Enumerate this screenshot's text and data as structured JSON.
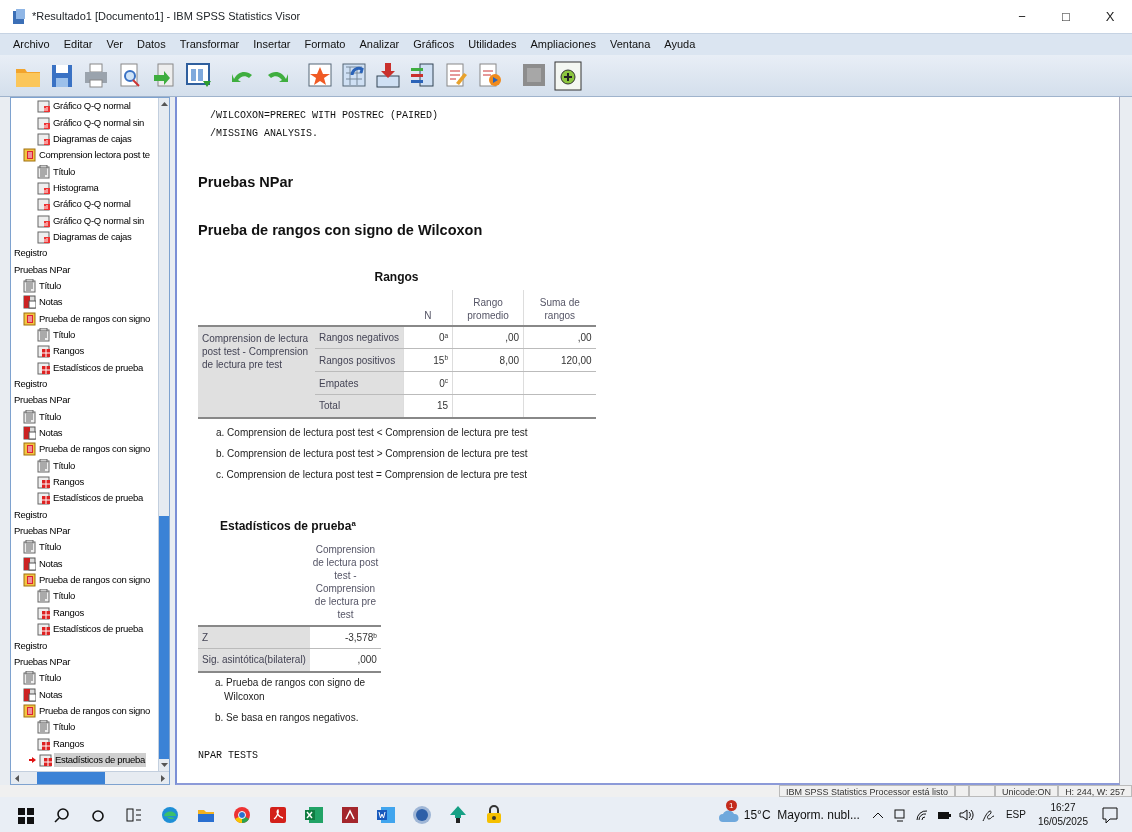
{
  "window": {
    "title": "*Resultado1 [Documento1] - IBM SPSS Statistics Visor",
    "controls": [
      "−",
      "□",
      "X"
    ]
  },
  "menu": [
    "Archivo",
    "Editar",
    "Ver",
    "Datos",
    "Transformar",
    "Insertar",
    "Formato",
    "Analizar",
    "Gráficos",
    "Utilidades",
    "Ampliaciones",
    "Ventana",
    "Ayuda"
  ],
  "tree": [
    {
      "children": [
        {
          "children": [
            {
              "label": "Gráfico Q-Q normal",
              "kind": "chart",
              "selected": false
            },
            {
              "label": "Gráfico Q-Q normal sin",
              "kind": "chart",
              "selected": false
            },
            {
              "label": "Diagramas de cajas",
              "kind": "chart",
              "selected": false
            }
          ]
        },
        {
          "label": "Comprension lectora post te",
          "kind": "heading",
          "selected": false,
          "children": [
            {
              "label": "Título",
              "kind": "title",
              "selected": false
            },
            {
              "label": "Histograma",
              "kind": "chart",
              "selected": false
            },
            {
              "label": "Gráfico Q-Q normal",
              "kind": "chart",
              "selected": false
            },
            {
              "label": "Gráfico Q-Q normal sin",
              "kind": "chart",
              "selected": false
            },
            {
              "label": "Diagramas de cajas",
              "kind": "chart",
              "selected": false
            }
          ]
        }
      ]
    },
    {
      "label": "Registro",
      "selected": false
    },
    {
      "label": "Pruebas NPar",
      "selected": false,
      "children": [
        {
          "label": "Título",
          "kind": "title",
          "selected": false
        },
        {
          "label": "Notas",
          "kind": "notes",
          "selected": false
        },
        {
          "label": "Prueba de rangos con signo",
          "kind": "heading",
          "selected": false,
          "children": [
            {
              "label": "Título",
              "kind": "title",
              "selected": false
            },
            {
              "label": "Rangos",
              "kind": "table",
              "selected": false
            },
            {
              "label": "Estadísticos de prueba",
              "kind": "table",
              "selected": false
            }
          ]
        }
      ]
    },
    {
      "label": "Registro",
      "selected": false
    },
    {
      "label": "Pruebas NPar",
      "selected": false,
      "children": [
        {
          "label": "Título",
          "kind": "title",
          "selected": false
        },
        {
          "label": "Notas",
          "kind": "notes",
          "selected": false
        },
        {
          "label": "Prueba de rangos con signo",
          "kind": "heading",
          "selected": false,
          "children": [
            {
              "label": "Título",
              "kind": "title",
              "selected": false
            },
            {
              "label": "Rangos",
              "kind": "table",
              "selected": false
            },
            {
              "label": "Estadísticos de prueba",
              "kind": "table",
              "selected": false
            }
          ]
        }
      ]
    },
    {
      "label": "Registro",
      "selected": false
    },
    {
      "label": "Pruebas NPar",
      "selected": false,
      "children": [
        {
          "label": "Título",
          "kind": "title",
          "selected": false
        },
        {
          "label": "Notas",
          "kind": "notes",
          "selected": false
        },
        {
          "label": "Prueba de rangos con signo",
          "kind": "heading",
          "selected": false,
          "children": [
            {
              "label": "Título",
              "kind": "title",
              "selected": false
            },
            {
              "label": "Rangos",
              "kind": "table",
              "selected": false
            },
            {
              "label": "Estadísticos de prueba",
              "kind": "table",
              "selected": false
            }
          ]
        }
      ]
    },
    {
      "label": "Registro",
      "selected": false
    },
    {
      "label": "Pruebas NPar",
      "selected": false,
      "children": [
        {
          "label": "Título",
          "kind": "title",
          "selected": false
        },
        {
          "label": "Notas",
          "kind": "notes",
          "selected": false
        },
        {
          "label": "Prueba de rangos con signo",
          "kind": "heading",
          "selected": false,
          "children": [
            {
              "label": "Título",
              "kind": "title",
              "selected": false
            },
            {
              "label": "Rangos",
              "kind": "table",
              "selected": false
            },
            {
              "label": "Estadísticos de prueba",
              "kind": "table",
              "selected": true
            }
          ]
        }
      ]
    }
  ],
  "output": {
    "syntax": [
      "/WILCOXON=PREREC WITH POSTREC (PAIRED)",
      "/MISSING ANALYSIS."
    ],
    "headings": [
      "Pruebas NPar",
      "Prueba de rangos con signo de Wilcoxon"
    ],
    "ranks_table": {
      "title": "Rangos",
      "columns": [
        "N",
        "Rango promedio",
        "Suma de rangos"
      ],
      "group_label": "Comprension de lectura post test - Comprension de lectura pre test",
      "rows": [
        {
          "label": "Rangos negativos",
          "cells": [
            "0$^{a}$",
            ",00",
            ",00"
          ]
        },
        {
          "label": "Rangos positivos",
          "cells": [
            "15$^{b}$",
            "8,00",
            "120,00"
          ]
        },
        {
          "label": "Empates",
          "cells": [
            "0$^{c}$"
          ]
        },
        {
          "label": "Total",
          "cells": [
            "15"
          ]
        }
      ],
      "footnotes": [
        "a. Comprension de lectura post test < Comprension de lectura pre test",
        "b. Comprension de lectura post test > Comprension de lectura pre test",
        "c. Comprension de lectura post test = Comprension de lectura pre test"
      ]
    },
    "stats_table": {
      "title": "Estadísticos de prueba$^{a}$",
      "column": "Comprension de lectura post test - Comprension de lectura pre test",
      "rows": [
        {
          "label": "Z",
          "value": "-3,578$^{b}$"
        },
        {
          "label": "Sig. asintótica(bilateral)",
          "value": ",000"
        }
      ],
      "footnotes": [
        "a. Prueba de rangos con signo de Wilcoxon",
        "b. Se basa en rangos negativos."
      ]
    },
    "syntax_end": "NPAR TESTS"
  },
  "status_bar": {
    "message": "IBM SPSS Statistics Processor está listo",
    "unicode": "Unicode:ON",
    "size": "H: 244, W: 257"
  },
  "taskbar": {
    "weather_badge": "1",
    "weather": "15°C  Mayorm. nubl...",
    "language": "ESP",
    "time": "16:27",
    "date": "16/05/2025"
  }
}
